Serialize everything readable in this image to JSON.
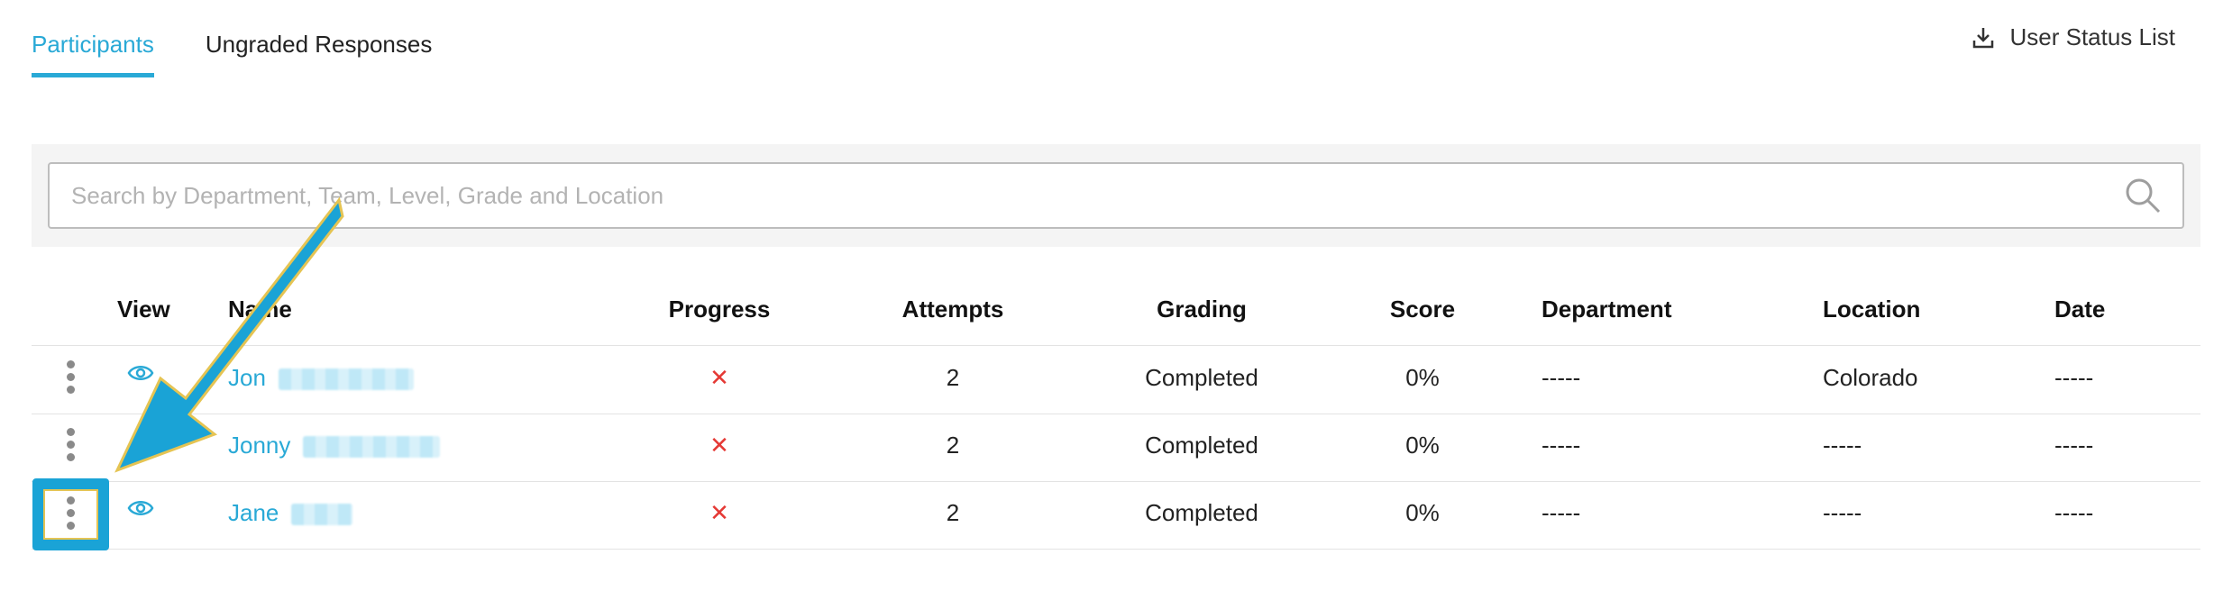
{
  "tabs": [
    {
      "label": "Participants",
      "active": true
    },
    {
      "label": "Ungraded Responses",
      "active": false
    }
  ],
  "user_status_list": {
    "label": "User Status List",
    "icon": "download-icon"
  },
  "search": {
    "placeholder": "Search by Department, Team, Level, Grade and Location",
    "value": ""
  },
  "table": {
    "headers": {
      "view": "View",
      "name": "Name",
      "progress": "Progress",
      "attempts": "Attempts",
      "grading": "Grading",
      "score": "Score",
      "department": "Department",
      "location": "Location",
      "date": "Date"
    },
    "rows": [
      {
        "name": "Jon",
        "progress": "✕",
        "attempts": "2",
        "grading": "Completed",
        "score": "0%",
        "department": "-----",
        "location": "Colorado",
        "date": "-----"
      },
      {
        "name": "Jonny",
        "progress": "✕",
        "attempts": "2",
        "grading": "Completed",
        "score": "0%",
        "department": "-----",
        "location": "-----",
        "date": "-----"
      },
      {
        "name": "Jane",
        "progress": "✕",
        "attempts": "2",
        "grading": "Completed",
        "score": "0%",
        "department": "-----",
        "location": "-----",
        "date": "-----"
      }
    ]
  },
  "colors": {
    "accent": "#29a9d6",
    "error": "#e53935",
    "annotation": "#1aa3d6"
  }
}
